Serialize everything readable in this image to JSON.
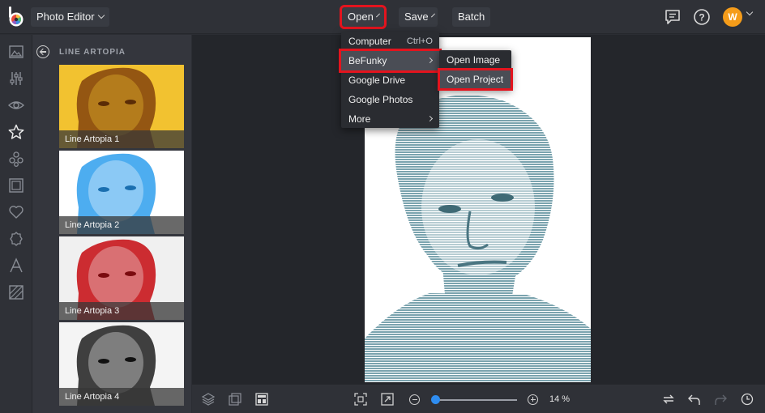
{
  "topbar": {
    "app_menu_label": "Photo Editor",
    "open_label": "Open",
    "save_label": "Save",
    "batch_label": "Batch",
    "avatar_initial": "W"
  },
  "open_menu": {
    "items": [
      {
        "label": "Computer",
        "shortcut": "Ctrl+O"
      },
      {
        "label": "BeFunky",
        "has_submenu": true
      },
      {
        "label": "Google Drive"
      },
      {
        "label": "Google Photos"
      },
      {
        "label": "More",
        "has_submenu": true
      }
    ]
  },
  "befunky_submenu": {
    "items": [
      {
        "label": "Open Image"
      },
      {
        "label": "Open Project"
      }
    ]
  },
  "panel": {
    "title": "LINE ARTOPIA",
    "thumbnails": [
      {
        "label": "Line Artopia 1",
        "color": "#f2c230",
        "ink": "#8a4a10"
      },
      {
        "label": "Line Artopia 2",
        "color": "#ffffff",
        "ink": "#3aa4ee"
      },
      {
        "label": "Line Artopia 3",
        "color": "#f0f0f0",
        "ink": "#c8161c"
      },
      {
        "label": "Line Artopia 4",
        "color": "#f4f4f4",
        "ink": "#2b2b2b"
      }
    ]
  },
  "canvas": {
    "photo_ink_color": "#7aa3ae"
  },
  "bottombar": {
    "zoom_label": "14 %",
    "zoom_fraction": 0.0
  },
  "colors": {
    "highlight": "#e3141e",
    "accent": "#2f8df0",
    "avatar": "#f59c1a"
  }
}
